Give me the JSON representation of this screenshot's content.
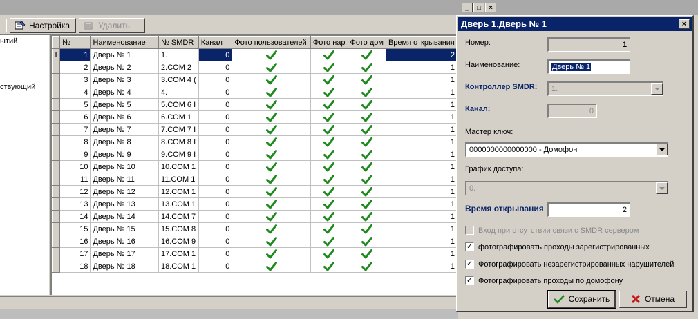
{
  "toolbar": {
    "settings_label": "Настройка",
    "delete_label": "Удалить"
  },
  "tree": {
    "items": [
      "ытий",
      "ствующий"
    ]
  },
  "grid": {
    "columns": [
      "№",
      "Наименование",
      "№ SMDR",
      "Канал",
      "Фото пользователей",
      "Фото нар",
      "Фото дом",
      "Время открывания"
    ],
    "indicator": "I",
    "rows": [
      {
        "num": "1",
        "name": "Дверь № 1",
        "smdr": "1.",
        "channel": "0",
        "time": "2"
      },
      {
        "num": "2",
        "name": "Дверь № 2",
        "smdr": "2.COM 2",
        "channel": "0",
        "time": "1"
      },
      {
        "num": "3",
        "name": "Дверь № 3",
        "smdr": "3.COM 4 (",
        "channel": "0",
        "time": "1"
      },
      {
        "num": "4",
        "name": "Дверь № 4",
        "smdr": "4.",
        "channel": "0",
        "time": "1"
      },
      {
        "num": "5",
        "name": "Дверь № 5",
        "smdr": "5.COM 6 I",
        "channel": "0",
        "time": "1"
      },
      {
        "num": "6",
        "name": "Дверь № 6",
        "smdr": "6.COM 1",
        "channel": "0",
        "time": "1"
      },
      {
        "num": "7",
        "name": "Дверь № 7",
        "smdr": "7.COM 7 I",
        "channel": "0",
        "time": "1"
      },
      {
        "num": "8",
        "name": "Дверь № 8",
        "smdr": "8.COM 8 I",
        "channel": "0",
        "time": "1"
      },
      {
        "num": "9",
        "name": "Дверь № 9",
        "smdr": "9.COM 9 I",
        "channel": "0",
        "time": "1"
      },
      {
        "num": "10",
        "name": "Дверь № 10",
        "smdr": "10.COM 1",
        "channel": "0",
        "time": "1"
      },
      {
        "num": "11",
        "name": "Дверь № 11",
        "smdr": "11.COM 1",
        "channel": "0",
        "time": "1"
      },
      {
        "num": "12",
        "name": "Дверь № 12",
        "smdr": "12.COM 1",
        "channel": "0",
        "time": "1"
      },
      {
        "num": "13",
        "name": "Дверь № 13",
        "smdr": "13.COM 1",
        "channel": "0",
        "time": "1"
      },
      {
        "num": "14",
        "name": "Дверь № 14",
        "smdr": "14.COM 7",
        "channel": "0",
        "time": "1"
      },
      {
        "num": "15",
        "name": "Дверь № 15",
        "smdr": "15.COM 8",
        "channel": "0",
        "time": "1"
      },
      {
        "num": "16",
        "name": "Дверь № 16",
        "smdr": "16.COM 9",
        "channel": "0",
        "time": "1"
      },
      {
        "num": "17",
        "name": "Дверь № 17",
        "smdr": "17.COM 1",
        "channel": "0",
        "time": "1"
      },
      {
        "num": "18",
        "name": "Дверь № 18",
        "smdr": "18.COM 1",
        "channel": "0",
        "time": "1"
      }
    ]
  },
  "mdi_buttons": [
    "_",
    "□",
    "×"
  ],
  "dialog": {
    "title": "Дверь 1.Дверь № 1",
    "close": "×",
    "number_label": "Номер:",
    "number_value": "1",
    "name_label": "Наименование:",
    "name_value": "Дверь № 1",
    "controller_label": "Контроллер SMDR:",
    "controller_value": "1.",
    "channel_label": "Канал:",
    "channel_value": "0",
    "master_key_label": "Мастер ключ:",
    "master_key_value": "0000000000000000 - Домофон",
    "schedule_label": "График доступа:",
    "schedule_value": "0.",
    "open_time_label": "Время открывания",
    "open_time_value": "2",
    "checkboxes": [
      {
        "label": "Вход при отсутствии связи с SMDR сервером",
        "checked": false,
        "disabled": true
      },
      {
        "label": "фотографировать проходы зарегистрированных",
        "checked": true,
        "disabled": false
      },
      {
        "label": "Фотографировать незарегистрированных нарушителей",
        "checked": true,
        "disabled": false
      },
      {
        "label": "Фотографировать проходы по домофону",
        "checked": true,
        "disabled": false
      }
    ],
    "save_label": "Сохранить",
    "cancel_label": "Отмена"
  },
  "colors": {
    "title_bar": "#0a246a",
    "check_green": "#1e8a1e",
    "cancel_red": "#c41a1a"
  }
}
